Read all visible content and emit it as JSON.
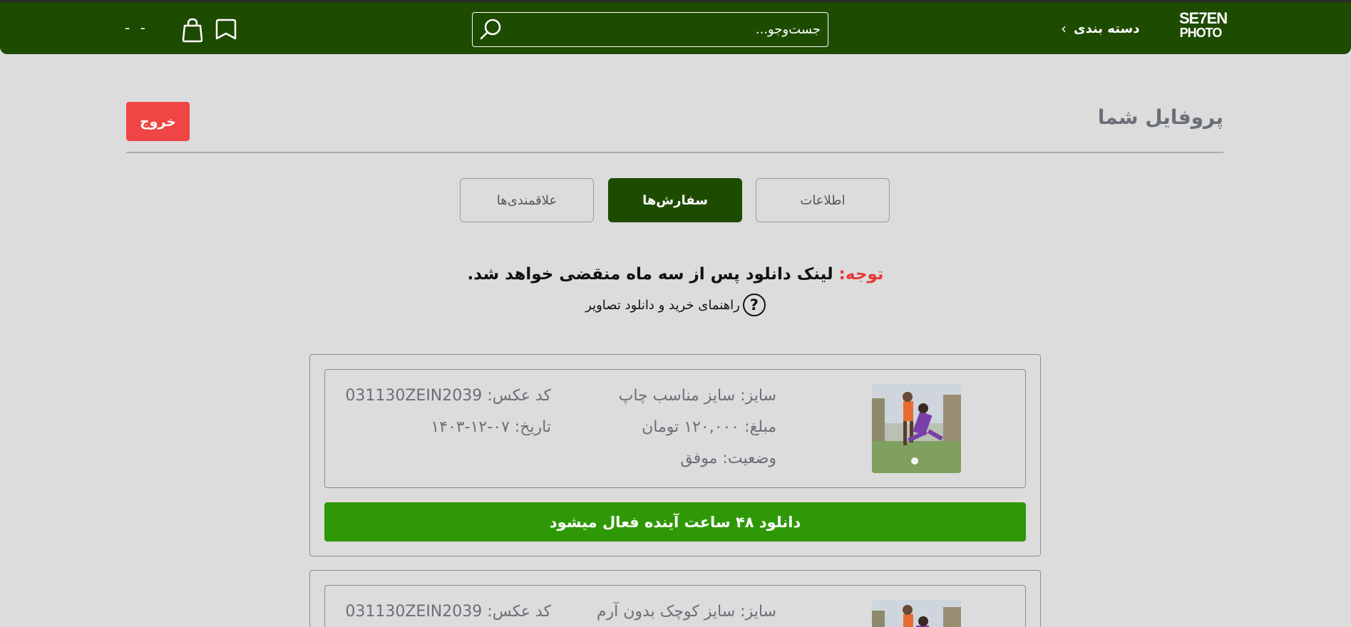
{
  "header": {
    "logo_top": "SE7EN",
    "logo_bottom": "PHOTO",
    "category_label": "دسته بندی",
    "search_placeholder": "جست‌وجو...",
    "user_text": "- -",
    "bg_color": "#1d4b00"
  },
  "profile": {
    "title": "پروفایل شما",
    "logout_label": "خروج"
  },
  "tabs": [
    {
      "label": "اطلاعات",
      "active": false
    },
    {
      "label": "سفارش‌ها",
      "active": true
    },
    {
      "label": "علاقمندی‌ها",
      "active": false
    }
  ],
  "notice": {
    "warn_label": "توجه:",
    "message": "لینک دانلود پس از سه ماه منقضی خواهد شد.",
    "guide_text": "راهنمای خرید و دانلود تصاویر",
    "guide_icon": "?"
  },
  "orders": [
    {
      "size": "سایز: سایز مناسب چاپ",
      "price": "مبلغ: ۱۲۰,۰۰۰ تومان",
      "status": "وضعیت: موفق",
      "code": "کد عکس: 031130ZEIN2039",
      "date": "تاریخ: ۰۷-۱۲-۱۴۰۳",
      "download_label": "دانلود ۴۸ ساعت آینده فعال میشود"
    },
    {
      "size": "سایز: سایز کوچک بدون آرم",
      "code": "کد عکس: 031130ZEIN2039"
    }
  ],
  "colors": {
    "accent_green": "#2f9807",
    "dark_green": "#1d4b00",
    "danger_red": "#ef4545",
    "warn_red": "#e83838"
  }
}
